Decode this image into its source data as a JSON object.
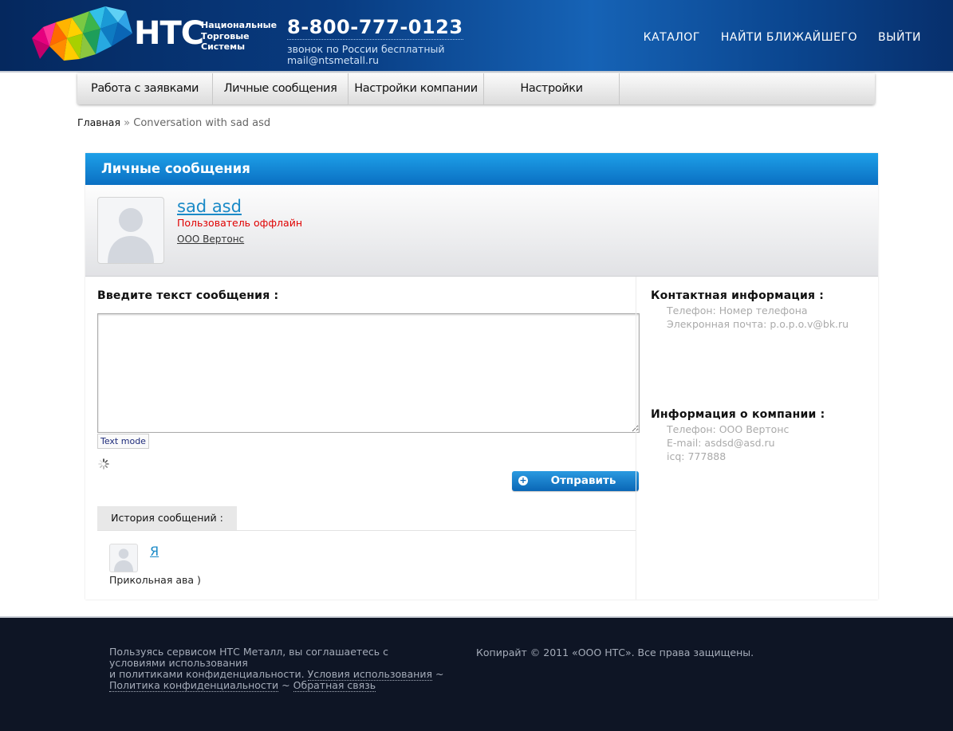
{
  "header": {
    "logo_word": "НТС",
    "logo_sub": [
      "Национальные",
      "Торговые",
      "Системы"
    ],
    "phone": "8-800-777-0123",
    "phone_note": "звонок по России бесплатный",
    "email": "mail@ntsmetall.ru",
    "nav": [
      "КАТАЛОГ",
      "НАЙТИ БЛИЖАЙШЕГО",
      "ВЫЙТИ"
    ]
  },
  "menu": [
    "Работа с заявками",
    "Личные сообщения",
    "Настройки компании",
    "Настройки"
  ],
  "breadcrumb": {
    "home": "Главная",
    "sep": "»",
    "current": "Conversation with sad asd"
  },
  "panel": {
    "title": "Личные сообщения",
    "profile": {
      "name": "sad asd",
      "status": "Пользователь оффлайн",
      "company": "ООО Вертонс"
    },
    "compose": {
      "label": "Введите текст сообщения :",
      "text_mode": "Text mode",
      "send": "Отправить"
    },
    "history": {
      "tab": "История сообщений :",
      "items": [
        {
          "author": "Я",
          "text": "Прикольная ава )"
        }
      ]
    },
    "contact": {
      "title": "Контактная информация :",
      "phone": "Телефон: Номер телефона",
      "email": "Элекронная почта: p.o.p.o.v@bk.ru"
    },
    "company_info": {
      "title": "Информация о компании :",
      "phone": "Телефон: ООО Вертонс",
      "email": "E-mail: asdsd@asd.ru",
      "icq": "icq: 777888"
    }
  },
  "footer": {
    "left_text_1": "Пользуясь сервисом НТС Металл, вы соглашаетесь с условиями использования",
    "left_text_2": "и политиками конфиденциальности.",
    "link_terms": "Условия использования",
    "tilde": "~",
    "link_privacy": "Политика конфиденциальности",
    "link_feedback": "Обратная связь",
    "copyright": "Копирайт © 2011 «ООО НТС». Все права защищены."
  },
  "colors": {
    "accent": "#0a7fd0",
    "header_bg": "#083b80",
    "footer_bg": "#0e1525",
    "status_offline": "#e00000"
  }
}
